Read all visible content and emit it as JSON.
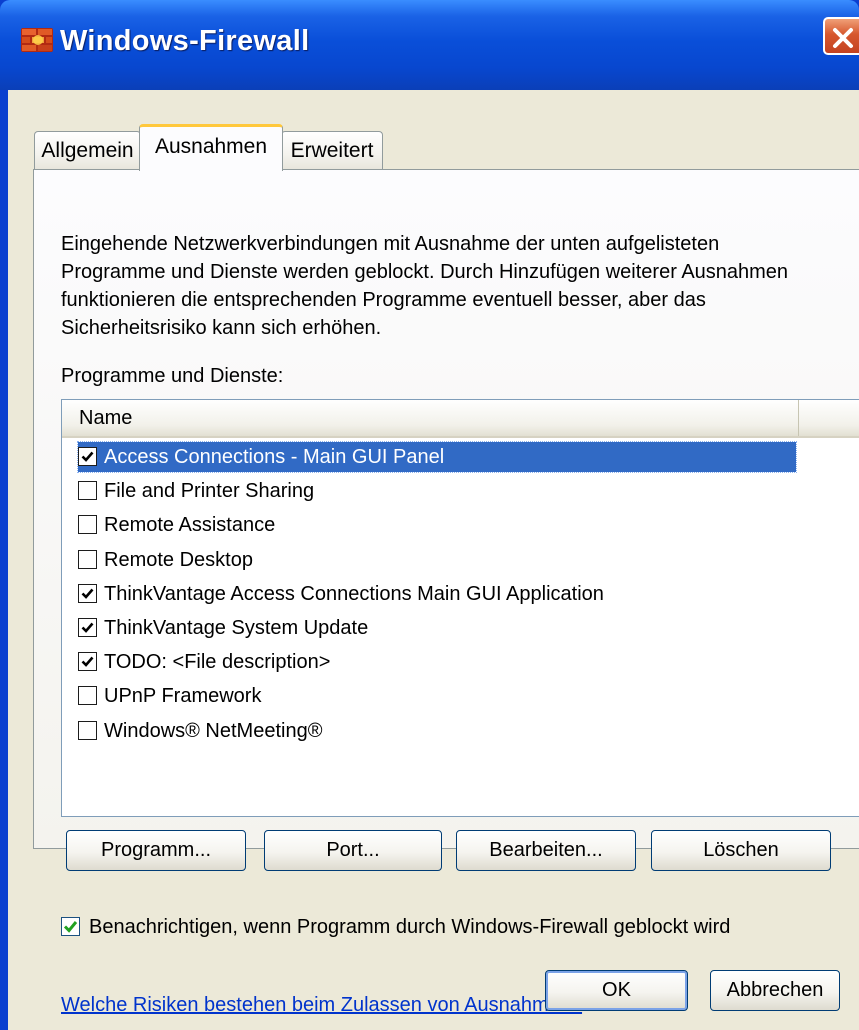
{
  "window": {
    "title": "Windows-Firewall"
  },
  "tabs": [
    {
      "label": "Allgemein",
      "active": false
    },
    {
      "label": "Ausnahmen",
      "active": true
    },
    {
      "label": "Erweitert",
      "active": false
    }
  ],
  "panel": {
    "intro_lines": [
      "Eingehende Netzwerkverbindungen mit Ausnahme der unten aufgelisteten",
      "Programme und Dienste werden geblockt. Durch Hinzufügen weiterer Ausnahmen",
      "funktionieren die entsprechenden Programme eventuell besser, aber das",
      "Sicherheitsrisiko kann sich erhöhen."
    ],
    "list_label": "Programme und Dienste:",
    "list_header": "Name",
    "items": [
      {
        "label": "Access Connections - Main GUI Panel",
        "checked": true,
        "selected": true
      },
      {
        "label": "File and Printer Sharing",
        "checked": false,
        "selected": false
      },
      {
        "label": "Remote Assistance",
        "checked": false,
        "selected": false
      },
      {
        "label": "Remote Desktop",
        "checked": false,
        "selected": false
      },
      {
        "label": "ThinkVantage Access Connections Main GUI Application",
        "checked": true,
        "selected": false
      },
      {
        "label": "ThinkVantage System Update",
        "checked": true,
        "selected": false
      },
      {
        "label": "TODO: <File description>",
        "checked": true,
        "selected": false
      },
      {
        "label": "UPnP Framework",
        "checked": false,
        "selected": false
      },
      {
        "label": "Windows® NetMeeting®",
        "checked": false,
        "selected": false
      }
    ],
    "buttons": {
      "programm": "Programm...",
      "port": "Port...",
      "bearbeiten": "Bearbeiten...",
      "loeschen": "Löschen"
    },
    "notify": {
      "label": "Benachrichtigen, wenn Programm durch Windows-Firewall geblockt wird",
      "checked": true
    },
    "help_link": "Welche Risiken bestehen beim Zulassen von Ausnahmen?"
  },
  "dialog_buttons": {
    "ok": "OK",
    "cancel": "Abbrechen"
  },
  "icons": {
    "app": "firewall-brick-icon",
    "close": "close-icon",
    "checkbox_tick": "checkmark-icon"
  },
  "colors": {
    "titlebar": "#0a4fd9",
    "dialog_face": "#ece9d8",
    "selection": "#316ac5",
    "close_button": "#d6582e",
    "link": "#0033cc",
    "notify_tick": "#21a121"
  }
}
